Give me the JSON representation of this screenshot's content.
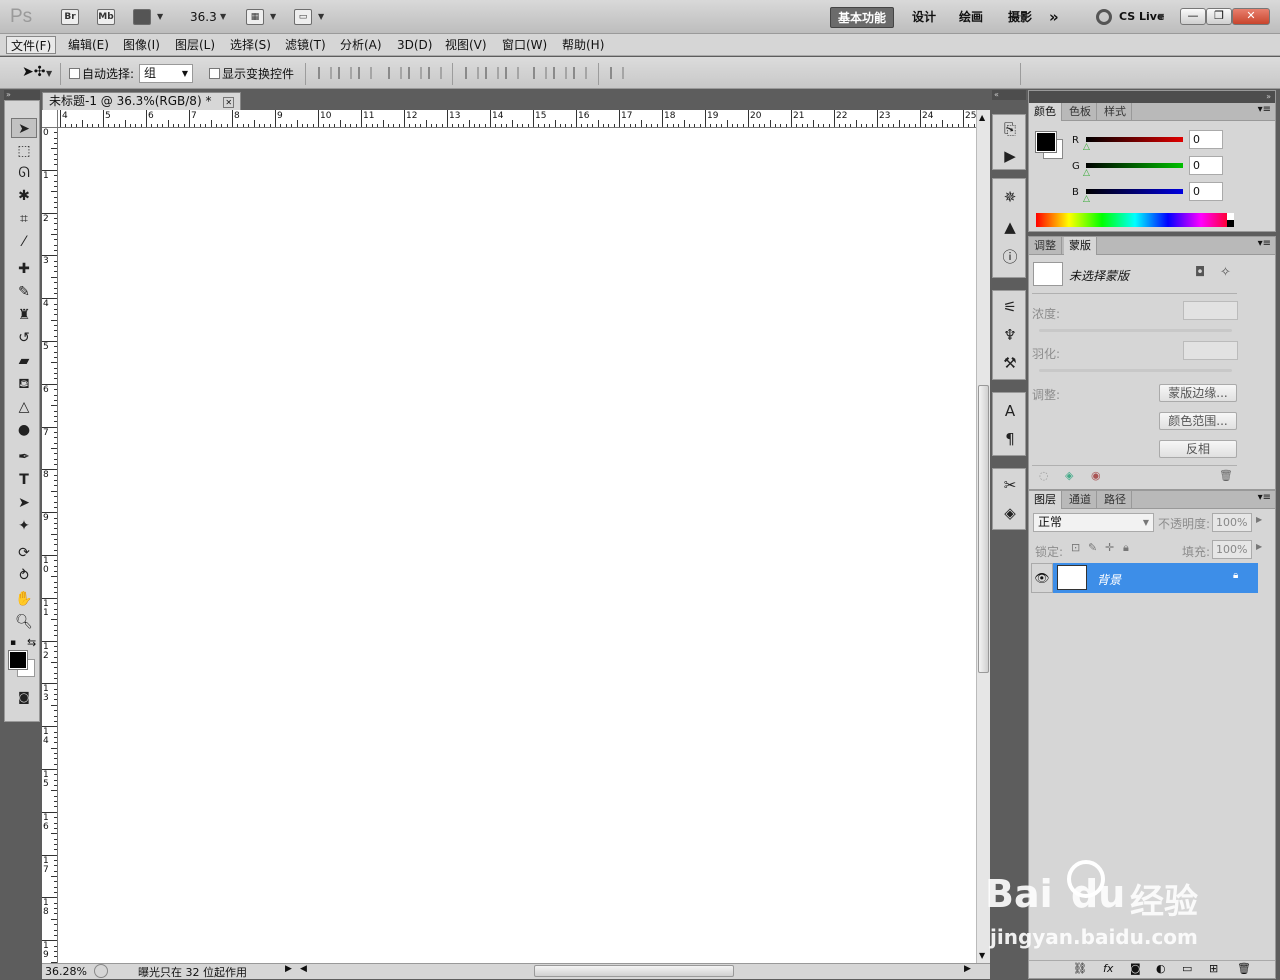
{
  "app": {
    "logo": "Ps",
    "bridge": "Br",
    "mini_bridge": "Mb",
    "zoom_value": "36.3",
    "workspaces": [
      "基本功能",
      "设计",
      "绘画",
      "摄影"
    ],
    "overflow": "»",
    "cs_live": "CS Live",
    "window_controls": [
      "—",
      "❐",
      "✕"
    ]
  },
  "menu": [
    "文件(F)",
    "编辑(E)",
    "图像(I)",
    "图层(L)",
    "选择(S)",
    "滤镜(T)",
    "分析(A)",
    "3D(D)",
    "视图(V)",
    "窗口(W)",
    "帮助(H)"
  ],
  "options": {
    "auto_select_label": "自动选择:",
    "auto_select_value": "组",
    "show_transform_label": "显示变换控件"
  },
  "document": {
    "tab_title": "未标题-1 @ 36.3%(RGB/8) *",
    "close": "✕",
    "ruler_top": [
      "4",
      "5",
      "6",
      "7",
      "8",
      "9",
      "10",
      "11",
      "12",
      "13",
      "14",
      "15",
      "16",
      "17",
      "18",
      "19",
      "20",
      "21",
      "22",
      "23",
      "24",
      "25"
    ],
    "ruler_left": [
      "0",
      "1",
      "2",
      "3",
      "4",
      "5",
      "6",
      "7",
      "8",
      "9",
      "10",
      "11",
      "12",
      "13",
      "14",
      "15",
      "16",
      "17",
      "18",
      "19"
    ]
  },
  "status": {
    "zoom": "36.28%",
    "info": "曝光只在 32 位起作用"
  },
  "color_panel": {
    "tabs": [
      "颜色",
      "色板",
      "样式"
    ],
    "channels": [
      {
        "label": "R",
        "value": "0",
        "color": "#e00000"
      },
      {
        "label": "G",
        "value": "0",
        "color": "#00c000"
      },
      {
        "label": "B",
        "value": "0",
        "color": "#0000e0"
      }
    ]
  },
  "masks_panel": {
    "tabs": [
      "调整",
      "蒙版"
    ],
    "no_mask": "未选择蒙版",
    "density_label": "浓度:",
    "feather_label": "羽化:",
    "refine_label": "调整:",
    "buttons": [
      "蒙版边缘...",
      "颜色范围...",
      "反相"
    ]
  },
  "layers_panel": {
    "tabs": [
      "图层",
      "通道",
      "路径"
    ],
    "blend_mode": "正常",
    "opacity_label": "不透明度:",
    "opacity_value": "100%",
    "lock_label": "锁定:",
    "fill_label": "填充:",
    "fill_value": "100%",
    "layer_name": "背景"
  },
  "watermark": {
    "brand": "Bai",
    "brand2": "du",
    "cn": "经验",
    "url": "jingyan.baidu.com"
  }
}
